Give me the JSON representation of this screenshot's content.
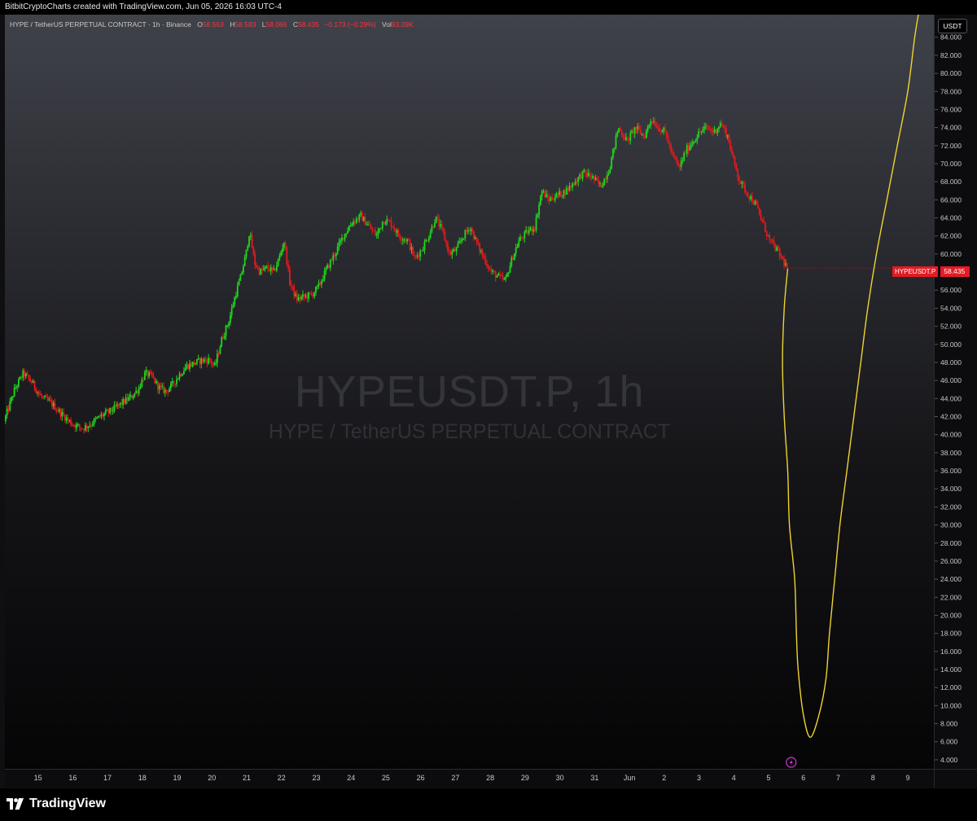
{
  "header": {
    "attribution": "BitbitCryptoCharts created with TradingView.com, Jun 05, 2026 16:03 UTC-4"
  },
  "legend": {
    "symbol": "HYPE / TetherUS PERPETUAL CONTRACT · 1h · Binance",
    "open_label": "O",
    "open": "58.563",
    "high_label": "H",
    "high": "58.583",
    "low_label": "L",
    "low": "58.066",
    "close_label": "C",
    "close": "58.435",
    "change": "−0.173 (−0.29%)",
    "vol_label": "Vol",
    "vol": "93.09K"
  },
  "currency_button": "USDT",
  "watermark": {
    "main": "HYPEUSDT.P, 1h",
    "sub": "HYPE / TetherUS PERPETUAL CONTRACT"
  },
  "price_badge": {
    "symbol": "HYPEUSDT.P",
    "value": "58.435"
  },
  "footer": {
    "brand": "TradingView"
  },
  "colors": {
    "up": "#22d61e",
    "down": "#e5191c",
    "projection": "#f0d32f",
    "badge": "#e21b24"
  },
  "chart_data": {
    "type": "candlestick",
    "timeframe": "1h",
    "y_axis": {
      "ticks": [
        "84.000",
        "82.000",
        "80.000",
        "78.000",
        "76.000",
        "74.000",
        "72.000",
        "70.000",
        "68.000",
        "66.000",
        "64.000",
        "62.000",
        "60.000",
        "58.000",
        "56.000",
        "54.000",
        "52.000",
        "50.000",
        "48.000",
        "46.000",
        "44.000",
        "42.000",
        "40.000",
        "38.000",
        "36.000",
        "34.000",
        "32.000",
        "30.000",
        "28.000",
        "26.000",
        "24.000",
        "22.000",
        "20.000",
        "18.000",
        "16.000",
        "14.000",
        "12.000",
        "10.000",
        "8.000",
        "6.000",
        "4.000"
      ],
      "ylim": [
        3.0,
        86.5
      ]
    },
    "x_axis": {
      "ticks": [
        "15",
        "16",
        "17",
        "18",
        "19",
        "20",
        "21",
        "22",
        "23",
        "24",
        "25",
        "26",
        "27",
        "28",
        "29",
        "30",
        "31",
        "Jun",
        "2",
        "3",
        "4",
        "5",
        "6",
        "7",
        "8",
        "9"
      ],
      "xlim": [
        14.05,
        40.75
      ]
    },
    "price_path": [
      [
        14.05,
        41.5
      ],
      [
        14.35,
        45.0
      ],
      [
        14.6,
        46.8
      ],
      [
        14.85,
        45.8
      ],
      [
        15.1,
        44.2
      ],
      [
        15.4,
        43.5
      ],
      [
        15.7,
        42.3
      ],
      [
        16.0,
        41.2
      ],
      [
        16.3,
        40.7
      ],
      [
        16.55,
        41.2
      ],
      [
        16.8,
        42.0
      ],
      [
        17.1,
        42.6
      ],
      [
        17.4,
        43.4
      ],
      [
        17.7,
        44.2
      ],
      [
        17.9,
        45.0
      ],
      [
        18.1,
        46.8
      ],
      [
        18.3,
        46.4
      ],
      [
        18.5,
        45.2
      ],
      [
        18.7,
        44.8
      ],
      [
        18.9,
        45.6
      ],
      [
        19.1,
        46.7
      ],
      [
        19.3,
        47.6
      ],
      [
        19.5,
        47.9
      ],
      [
        19.7,
        48.2
      ],
      [
        19.95,
        48.3
      ],
      [
        20.1,
        47.5
      ],
      [
        20.3,
        50.5
      ],
      [
        20.5,
        52.5
      ],
      [
        20.7,
        55.5
      ],
      [
        20.85,
        57.5
      ],
      [
        21.0,
        60.0
      ],
      [
        21.1,
        62.5
      ],
      [
        21.25,
        59.0
      ],
      [
        21.4,
        58.0
      ],
      [
        21.6,
        58.5
      ],
      [
        21.8,
        58.0
      ],
      [
        21.95,
        59.5
      ],
      [
        22.1,
        61.5
      ],
      [
        22.25,
        57.0
      ],
      [
        22.45,
        55.0
      ],
      [
        22.7,
        55.3
      ],
      [
        22.9,
        55.5
      ],
      [
        23.1,
        56.5
      ],
      [
        23.3,
        58.2
      ],
      [
        23.55,
        60.0
      ],
      [
        23.8,
        62.0
      ],
      [
        24.05,
        63.5
      ],
      [
        24.3,
        64.2
      ],
      [
        24.55,
        63.0
      ],
      [
        24.75,
        62.0
      ],
      [
        24.95,
        63.8
      ],
      [
        25.15,
        63.5
      ],
      [
        25.4,
        62.0
      ],
      [
        25.65,
        61.5
      ],
      [
        25.85,
        59.5
      ],
      [
        26.05,
        60.5
      ],
      [
        26.25,
        62.0
      ],
      [
        26.45,
        64.0
      ],
      [
        26.65,
        62.5
      ],
      [
        26.85,
        60.0
      ],
      [
        27.05,
        60.5
      ],
      [
        27.25,
        62.0
      ],
      [
        27.45,
        63.0
      ],
      [
        27.65,
        61.0
      ],
      [
        27.85,
        59.5
      ],
      [
        28.05,
        58.0
      ],
      [
        28.25,
        57.5
      ],
      [
        28.45,
        57.0
      ],
      [
        28.65,
        59.5
      ],
      [
        28.85,
        61.5
      ],
      [
        29.1,
        62.5
      ],
      [
        29.3,
        63.0
      ],
      [
        29.5,
        67.0
      ],
      [
        29.7,
        66.0
      ],
      [
        29.95,
        66.5
      ],
      [
        30.2,
        67.0
      ],
      [
        30.45,
        68.0
      ],
      [
        30.7,
        69.0
      ],
      [
        30.95,
        68.5
      ],
      [
        31.2,
        67.5
      ],
      [
        31.45,
        69.5
      ],
      [
        31.7,
        74.0
      ],
      [
        31.95,
        72.5
      ],
      [
        32.2,
        74.0
      ],
      [
        32.45,
        73.0
      ],
      [
        32.65,
        75.0
      ],
      [
        32.85,
        74.0
      ],
      [
        33.05,
        73.5
      ],
      [
        33.25,
        71.0
      ],
      [
        33.45,
        69.5
      ],
      [
        33.65,
        71.5
      ],
      [
        33.85,
        72.5
      ],
      [
        34.05,
        73.5
      ],
      [
        34.25,
        74.0
      ],
      [
        34.45,
        73.5
      ],
      [
        34.65,
        74.5
      ],
      [
        34.85,
        73.0
      ],
      [
        35.0,
        70.5
      ],
      [
        35.2,
        68.0
      ],
      [
        35.45,
        66.5
      ],
      [
        35.65,
        65.5
      ],
      [
        35.85,
        63.5
      ],
      [
        36.05,
        61.5
      ],
      [
        36.25,
        60.5
      ],
      [
        36.4,
        59.5
      ],
      [
        36.55,
        58.5
      ]
    ],
    "projection_line": [
      [
        36.55,
        58.4
      ],
      [
        36.45,
        54.0
      ],
      [
        36.4,
        48.0
      ],
      [
        36.45,
        42.0
      ],
      [
        36.55,
        36.0
      ],
      [
        36.6,
        30.0
      ],
      [
        36.75,
        24.0
      ],
      [
        36.8,
        18.0
      ],
      [
        36.85,
        14.0
      ],
      [
        37.0,
        9.0
      ],
      [
        37.2,
        6.5
      ],
      [
        37.45,
        9.0
      ],
      [
        37.65,
        13.0
      ],
      [
        37.75,
        18.0
      ],
      [
        37.9,
        24.0
      ],
      [
        38.05,
        30.0
      ],
      [
        38.25,
        36.0
      ],
      [
        38.45,
        42.0
      ],
      [
        38.65,
        48.0
      ],
      [
        38.85,
        54.0
      ],
      [
        39.1,
        60.0
      ],
      [
        39.4,
        66.0
      ],
      [
        39.7,
        72.0
      ],
      [
        40.0,
        78.0
      ],
      [
        40.2,
        84.0
      ],
      [
        40.35,
        87.5
      ]
    ],
    "last_price": 58.435,
    "last_symbol": "HYPEUSDT.P"
  }
}
